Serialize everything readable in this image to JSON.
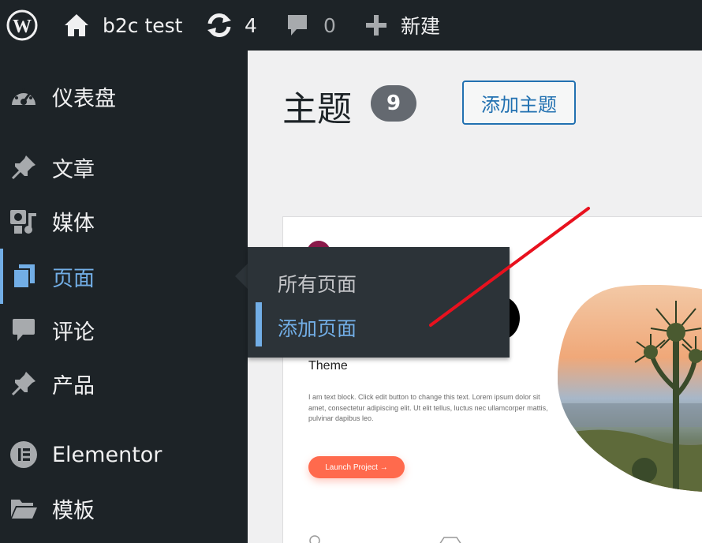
{
  "adminbar": {
    "site_name": "b2c test",
    "updates_count": "4",
    "comments_count": "0",
    "new_label": "新建",
    "icons": [
      "wordpress-logo-icon",
      "home-icon",
      "updates-icon",
      "comment-icon",
      "plus-icon"
    ]
  },
  "sidebar": {
    "items": [
      {
        "label": "仪表盘",
        "icon": "dashboard-icon"
      },
      {
        "label": "文章",
        "icon": "pin-icon"
      },
      {
        "label": "媒体",
        "icon": "media-icon"
      },
      {
        "label": "页面",
        "icon": "pages-icon",
        "active": true
      },
      {
        "label": "评论",
        "icon": "comment-icon"
      },
      {
        "label": "产品",
        "icon": "pin-icon"
      },
      {
        "label": "Elementor",
        "icon": "elementor-icon"
      },
      {
        "label": "模板",
        "icon": "folder-icon"
      }
    ],
    "flyout": {
      "items": [
        {
          "label": "所有页面",
          "current": false
        },
        {
          "label": "添加页面",
          "current": true
        }
      ]
    }
  },
  "main": {
    "title": "主题",
    "count": "9",
    "add_button": "添加主题",
    "theme_preview": {
      "heading": "Theme",
      "paragraph": "I am text block. Click edit button to change this text. Lorem ipsum dolor sit amet, consectetur adipiscing elit. Ut elit tellus, luctus nec ullamcorper mattis, pulvinar dapibus leo.",
      "button": "Launch Project  →"
    }
  },
  "colors": {
    "adminbar_bg": "#1d2327",
    "accent_blue": "#72aee6",
    "button_blue": "#2271b1",
    "badge_gray": "#646970",
    "launch_orange": "#ff6a4d",
    "annotation_red": "#e8111e"
  }
}
